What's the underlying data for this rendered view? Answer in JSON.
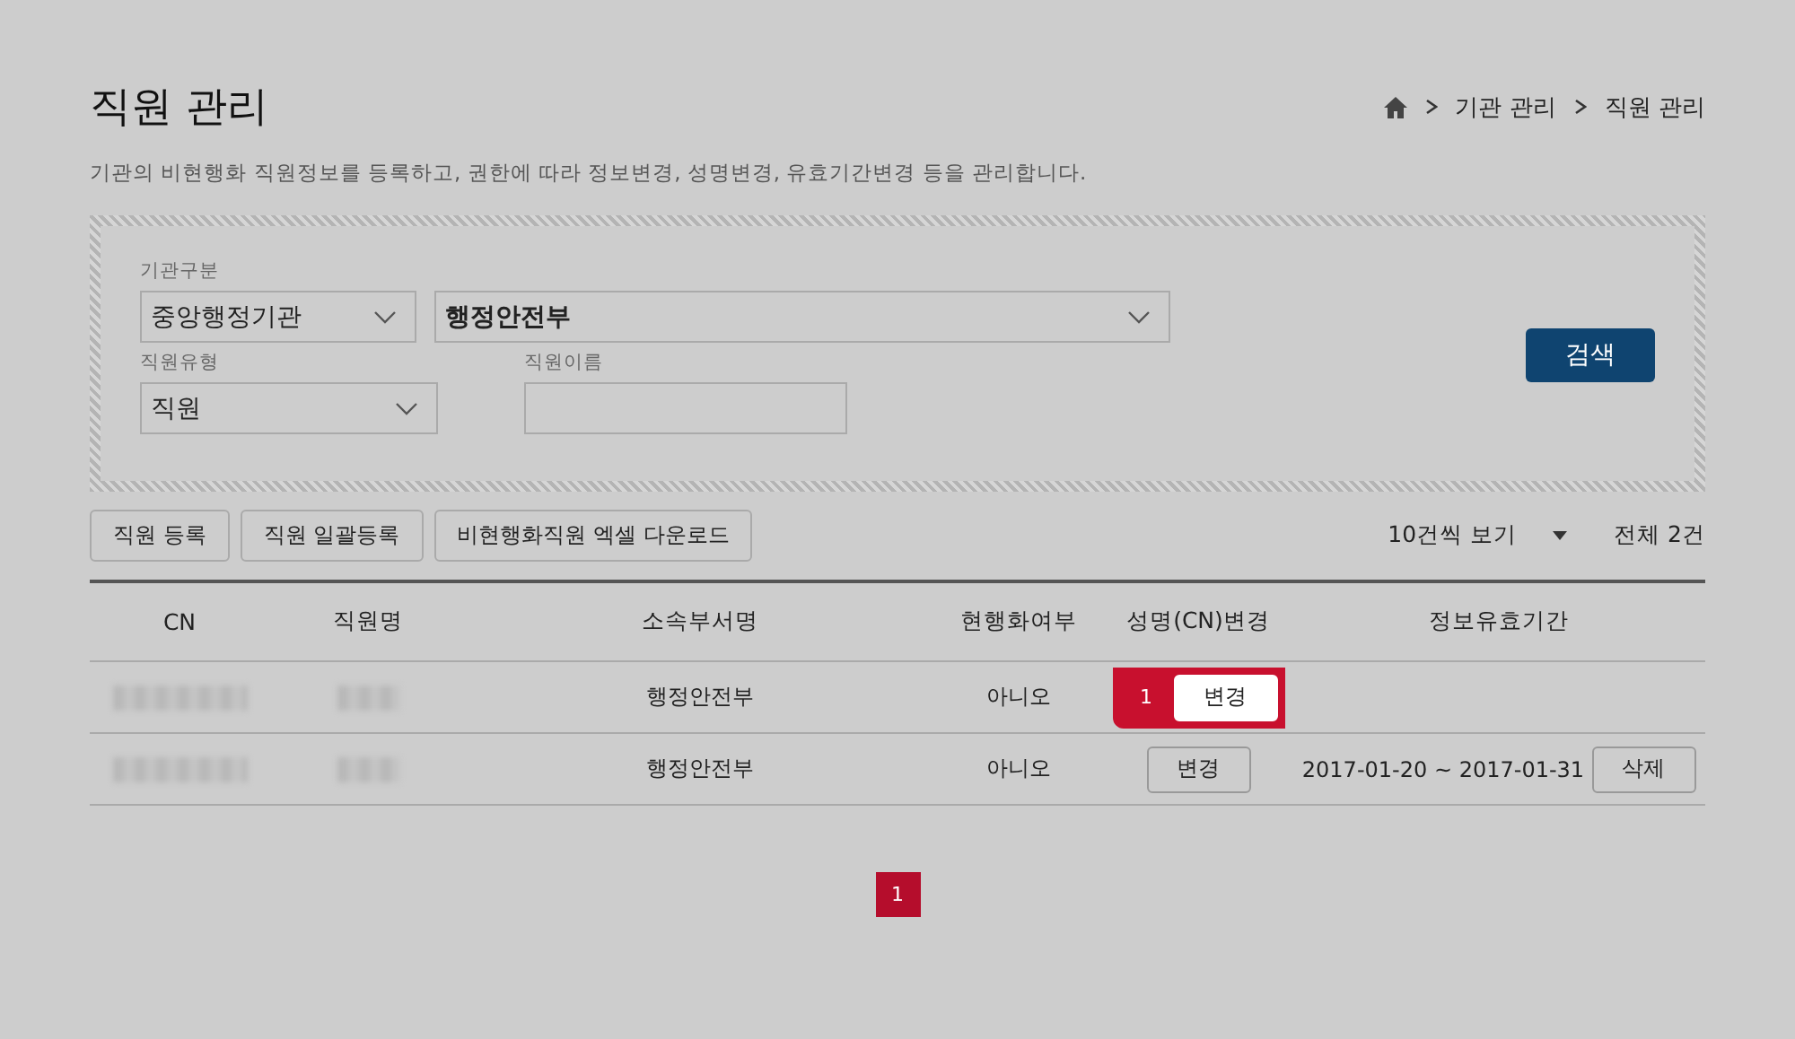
{
  "title": "직원 관리",
  "breadcrumb": [
    "기관 관리",
    "직원 관리"
  ],
  "description": "기관의 비현행화 직원정보를 등록하고, 권한에 따라 정보변경, 성명변경, 유효기간변경 등을 관리합니다.",
  "search": {
    "org_type": {
      "label": "기관구분",
      "value": "중앙행정기관"
    },
    "org": {
      "value": "행정안전부"
    },
    "staff_type": {
      "label": "직원유형",
      "value": "직원"
    },
    "staff_name": {
      "label": "직원이름"
    },
    "button": "검색"
  },
  "actions": [
    "직원 등록",
    "직원 일괄등록",
    "비현행화직원 엑셀 다운로드"
  ],
  "page_size": "10건씩 보기",
  "total": "전체 2건",
  "table": {
    "columns": [
      "CN",
      "직원명",
      "소속부서명",
      "현행화여부",
      "성명(CN)변경",
      "정보유효기간"
    ],
    "rows": [
      {
        "cn_redacted": true,
        "name_redacted": true,
        "department": "행정안전부",
        "current": "아니오",
        "change_button": "변경",
        "highlighted": true,
        "callout": "1"
      },
      {
        "cn_redacted": true,
        "name_redacted": true,
        "department": "행정안전부",
        "current": "아니오",
        "change_button": "변경",
        "highlighted": false,
        "period": "2017-01-20 ~ 2017-01-31",
        "delete_button": "삭제"
      }
    ]
  },
  "pagination": [
    {
      "label": "1",
      "selected": true
    }
  ]
}
